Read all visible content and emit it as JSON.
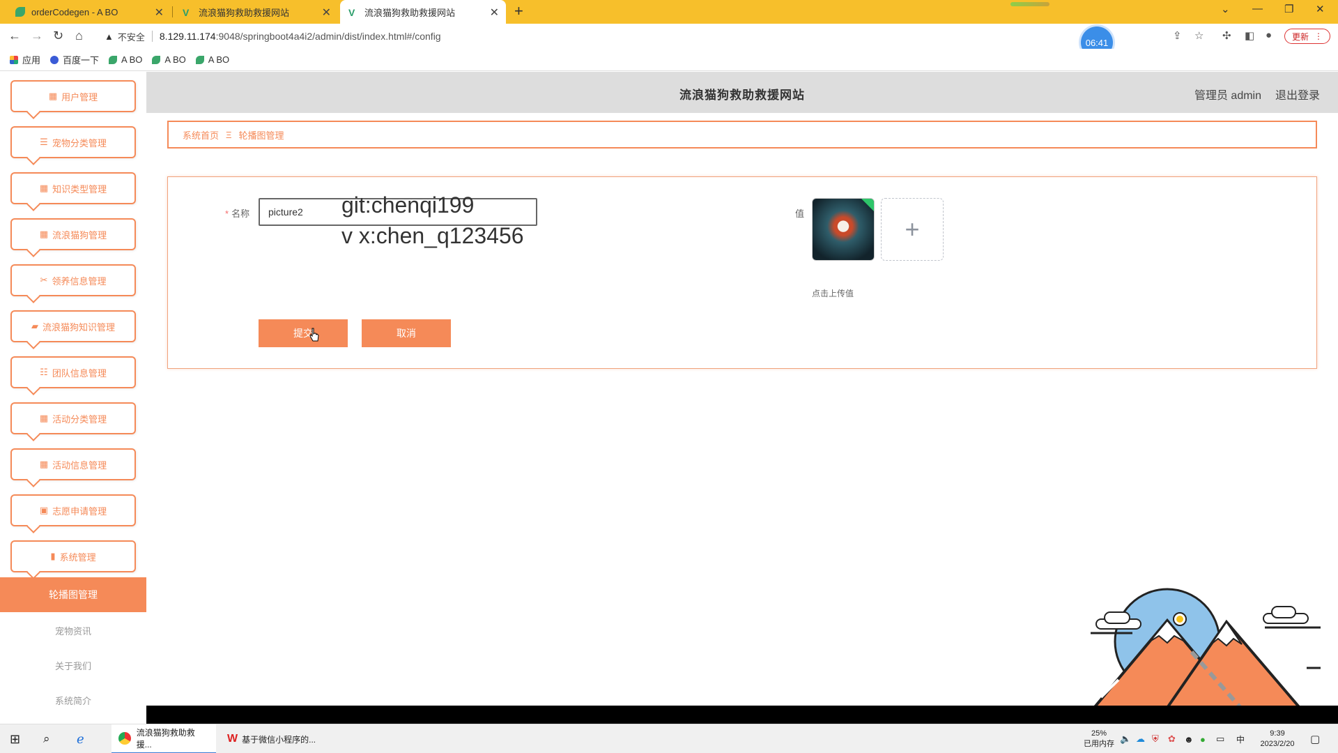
{
  "browser": {
    "tabs": [
      {
        "title": "orderCodegen - A BO",
        "active": false
      },
      {
        "title": "流浪猫狗救助救援网站",
        "active": false
      },
      {
        "title": "流浪猫狗救助救援网站",
        "active": true
      }
    ],
    "insecure_label": "不安全",
    "url_host": "8.129.11.174",
    "url_rest": ":9048/springboot4a4i2/admin/dist/index.html#/config",
    "timer": "06:41",
    "update_label": "更新",
    "bookmarks": [
      {
        "label": "应用",
        "icon": "apps-grid-icon"
      },
      {
        "label": "百度一下",
        "icon": "baidu-paw-icon"
      },
      {
        "label": "A BO",
        "icon": "leaf-icon"
      },
      {
        "label": "A BO",
        "icon": "leaf-icon"
      },
      {
        "label": "A BO",
        "icon": "leaf-icon"
      }
    ]
  },
  "theme": {
    "accent": "#f58a58",
    "header_bg": "#dddddd"
  },
  "sidebar": {
    "items": [
      {
        "label": "用户管理",
        "icon": "▦"
      },
      {
        "label": "宠物分类管理",
        "icon": "☰"
      },
      {
        "label": "知识类型管理",
        "icon": "▦"
      },
      {
        "label": "流浪猫狗管理",
        "icon": "▦"
      },
      {
        "label": "领养信息管理",
        "icon": "✂"
      },
      {
        "label": "流浪猫狗知识管理",
        "icon": "▰"
      },
      {
        "label": "团队信息管理",
        "icon": "☷"
      },
      {
        "label": "活动分类管理",
        "icon": "▦"
      },
      {
        "label": "活动信息管理",
        "icon": "▦"
      },
      {
        "label": "志愿申请管理",
        "icon": "▣"
      },
      {
        "label": "系统管理",
        "icon": "▮"
      }
    ],
    "sub_items": [
      {
        "label": "轮播图管理",
        "active": true
      },
      {
        "label": "宠物资讯",
        "active": false
      },
      {
        "label": "关于我们",
        "active": false
      },
      {
        "label": "系统简介",
        "active": false
      }
    ]
  },
  "header": {
    "title": "流浪猫狗救助救援网站",
    "admin": "管理员 admin",
    "logout": "退出登录"
  },
  "breadcrumb": {
    "home": "系统首页",
    "separator": "Ξ",
    "current": "轮播图管理"
  },
  "form": {
    "name_label": "名称",
    "name_value": "picture2",
    "value_label": "值",
    "upload_hint": "点击上传值",
    "upload_plus": "+",
    "submit_label": "提交",
    "cancel_label": "取消"
  },
  "watermark": {
    "line1": "git:chenqi199",
    "line2": "v x:chen_q123456"
  },
  "taskbar": {
    "apps": [
      {
        "label": "流浪猫狗救助救援...",
        "active": true
      },
      {
        "label": "基于微信小程序的...",
        "active": false
      }
    ],
    "memory_pct": "25%",
    "memory_label": "已用内存",
    "ime": "中",
    "time": "9:39",
    "date": "2023/2/20"
  }
}
